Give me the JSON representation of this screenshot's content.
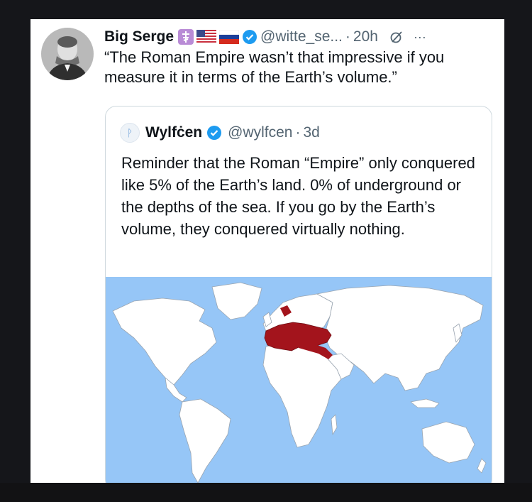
{
  "tweet": {
    "author_name": "Big Serge",
    "handle": "@witte_se...",
    "time": "20h",
    "separator": "·",
    "more": "···",
    "text": "“The Roman Empire wasn’t that impressive if you measure it in terms of the Earth’s volume.”",
    "flags": [
      "orthodox-cross-icon",
      "us-flag-icon",
      "russia-flag-icon"
    ]
  },
  "quote": {
    "author_name": "Wylfċen",
    "handle": "@wylfcen",
    "time": "3d",
    "separator": "·",
    "text": "Reminder that the Roman “Empire” only conquered like 5% of the Earth’s land. 0% of underground or the depths of the sea. If you go by the Earth’s volume, they conquered virtually nothing."
  },
  "colors": {
    "background": "#15161a",
    "card": "#ffffff",
    "verified": "#1d9bf0",
    "ocean": "#96c6f7",
    "roman_empire": "#a3141c",
    "text": "#0f1419",
    "muted": "#536471"
  }
}
